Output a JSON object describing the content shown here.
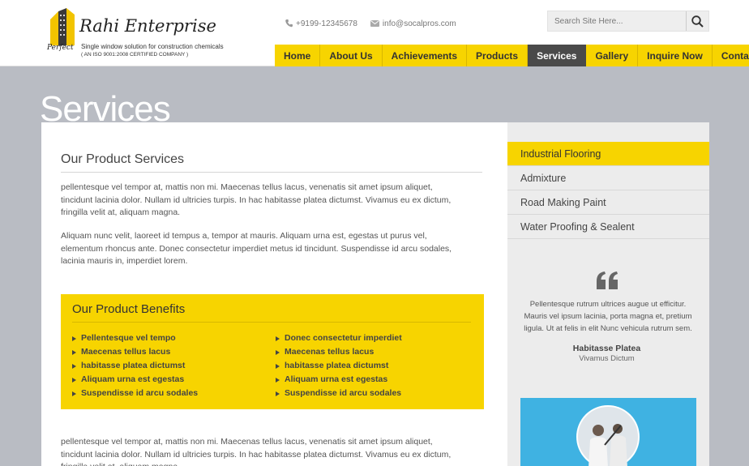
{
  "header": {
    "brand_word": "Perfect",
    "brand_name": "Rahi Enterprise",
    "tagline": "Single window solution for construction chemicals",
    "iso": "( AN ISO 9001:2008 CERTIFIED COMPANY )",
    "phone": "+9199-12345678",
    "email": "info@socalpros.com",
    "search_placeholder": "Search Site Here..."
  },
  "nav": {
    "items": [
      "Home",
      "About Us",
      "Achievements",
      "Products",
      "Services",
      "Gallery",
      "Inquire Now",
      "Contact Us"
    ],
    "active": "Services"
  },
  "page": {
    "title": "Services"
  },
  "main": {
    "heading": "Our Product Services",
    "para1": "pellentesque vel tempor at, mattis non mi. Maecenas tellus lacus, venenatis sit amet ipsum aliquet, tincidunt lacinia dolor. Nullam id ultricies turpis. In hac habitasse platea dictumst. Vivamus eu ex dictum, fringilla velit at, aliquam magna.",
    "para2": "Aliquam nunc velit, laoreet id tempus a, tempor at mauris. Aliquam urna est, egestas ut purus vel, elementum rhoncus ante. Donec consectetur imperdiet metus id tincidunt. Suspendisse id arcu sodales, lacinia mauris in, imperdiet lorem.",
    "para3": "pellentesque vel tempor at, mattis non mi. Maecenas tellus lacus, venenatis sit amet ipsum aliquet, tincidunt lacinia dolor. Nullam id ultricies turpis. In hac habitasse platea dictumst. Vivamus eu ex dictum, fringilla velit at, aliquam magna.",
    "benefits": {
      "heading": "Our Product Benefits",
      "col1": [
        "Pellentesque vel tempo",
        "Maecenas tellus lacus",
        "habitasse platea dictumst",
        "Aliquam urna est egestas",
        "Suspendisse id arcu sodales"
      ],
      "col2": [
        "Donec consectetur imperdiet",
        "Maecenas tellus lacus",
        "habitasse platea dictumst",
        "Aliquam urna est egestas",
        "Suspendisse id arcu sodales"
      ]
    }
  },
  "sidebar": {
    "menu": [
      "Industrial Flooring",
      "Admixture",
      "Road Making Paint",
      "Water Proofing & Sealent"
    ],
    "active": "Industrial Flooring",
    "testimonial": {
      "text": "Pellentesque rutrum ultrices augue ut efficitur. Mauris vel ipsum lacinia, porta magna et, pretium ligula. Ut at felis in elit Nunc vehicula rutrum sem.",
      "name": "Habitasse Platea",
      "role": "Vivamus Dictum"
    }
  },
  "colors": {
    "accent": "#f7d400",
    "nav_active": "#4a4a4a",
    "background": "#b9bcc3"
  }
}
